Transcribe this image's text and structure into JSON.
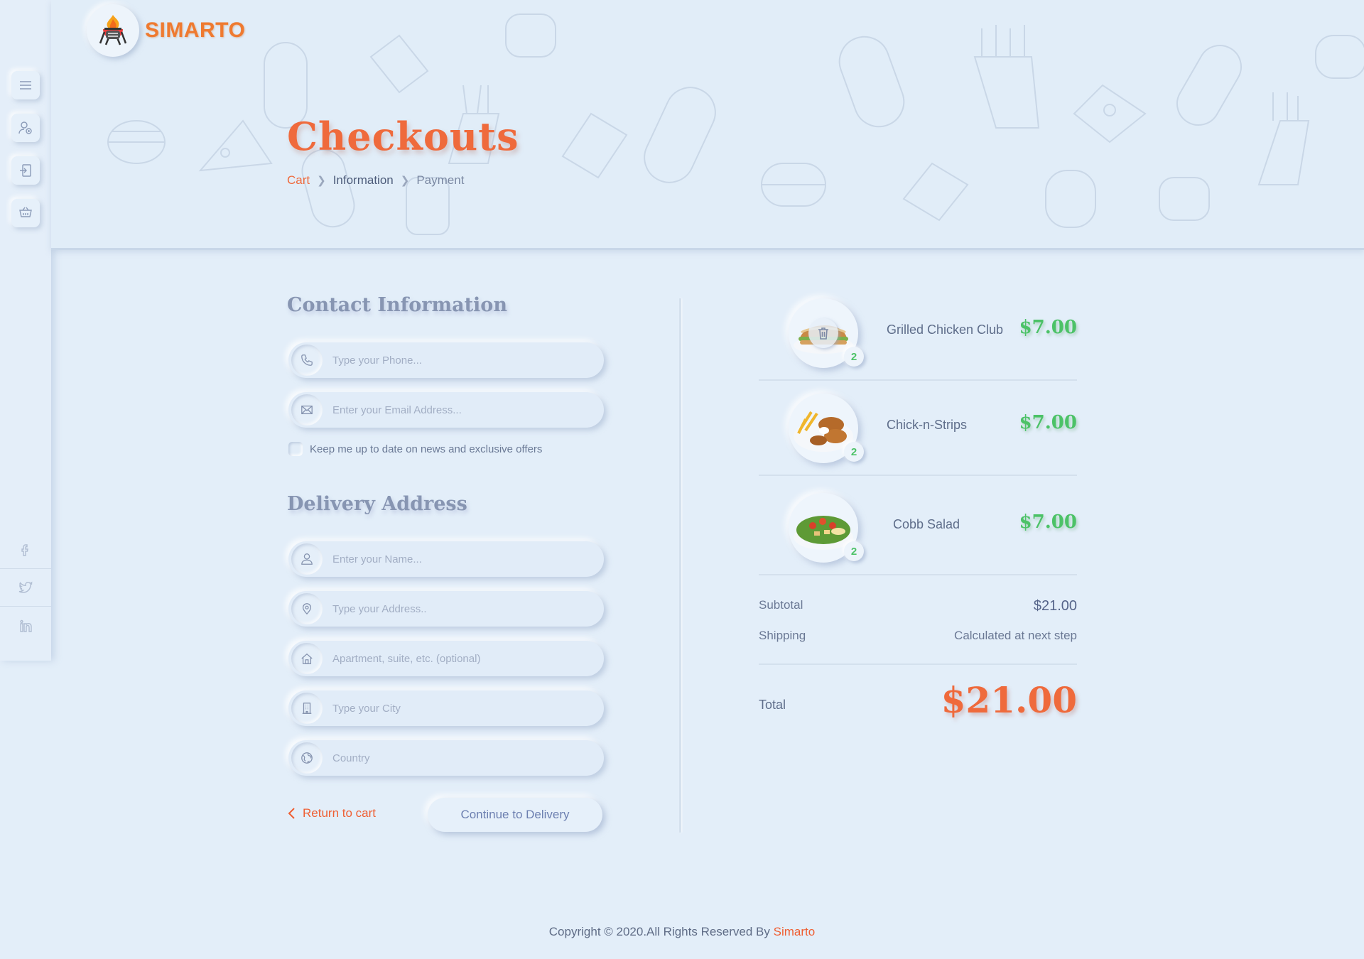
{
  "brand": {
    "name": "SIMARTO",
    "accent": "#ef6a3c"
  },
  "sidebar": {
    "items": [
      {
        "icon": "menu-icon"
      },
      {
        "icon": "user-add-icon"
      },
      {
        "icon": "login-icon"
      },
      {
        "icon": "cart-icon"
      }
    ],
    "social": [
      {
        "icon": "facebook-icon"
      },
      {
        "icon": "twitter-icon"
      },
      {
        "icon": "linkedin-icon"
      }
    ]
  },
  "header": {
    "title": "Checkouts",
    "breadcrumb": [
      "Cart",
      "Information",
      "Payment"
    ]
  },
  "contact": {
    "title": "Contact Information",
    "phone_placeholder": "Type your Phone...",
    "email_placeholder": "Enter your Email Address...",
    "newsletter_label": "Keep me up to date on news and exclusive offers"
  },
  "delivery": {
    "title": "Delivery Address",
    "name_placeholder": "Enter your Name...",
    "address_placeholder": "Type your Address..",
    "apartment_placeholder": "Apartment, suite, etc. (optional)",
    "city_placeholder": "Type your City",
    "country_placeholder": "Country"
  },
  "actions": {
    "return_label": "Return to cart",
    "continue_label": "Continue to Delivery"
  },
  "order": {
    "items": [
      {
        "name": "Grilled Chicken Club",
        "price": "$7.00",
        "qty": "2"
      },
      {
        "name": "Chick-n-Strips",
        "price": "$7.00",
        "qty": "2"
      },
      {
        "name": "Cobb Salad",
        "price": "$7.00",
        "qty": "2"
      }
    ],
    "subtotal_label": "Subtotal",
    "subtotal_value": "$21.00",
    "shipping_label": "Shipping",
    "shipping_value": "Calculated at next step",
    "total_label": "Total",
    "total_value": "$21.00"
  },
  "footer": {
    "copyright": "Copyright © 2020.All Rights Reserved By",
    "brand": "Simarto"
  }
}
